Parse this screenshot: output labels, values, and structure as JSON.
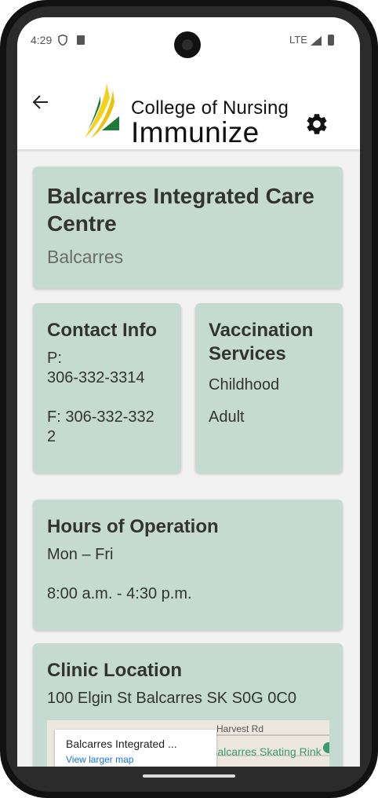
{
  "status": {
    "time": "4:29",
    "network": "LTE"
  },
  "appbar": {
    "logo_line1": "College of Nursing",
    "logo_line2": "Immunize"
  },
  "clinic": {
    "name": "Balcarres Integrated Care Centre",
    "town": "Balcarres"
  },
  "contact": {
    "heading": "Contact Info",
    "phone_prefix": "P:",
    "phone": "306-332-3314",
    "fax_line1": "F: 306-332-332",
    "fax_line2": "2"
  },
  "vaccination": {
    "heading": "Vaccination Services",
    "services": [
      "Childhood",
      "Adult"
    ]
  },
  "hours": {
    "heading": "Hours of Operation",
    "days": "Mon – Fri",
    "time": "8:00 a.m. - 4:30 p.m."
  },
  "location": {
    "heading": "Clinic Location",
    "address": "100 Elgin St Balcarres SK S0G 0C0",
    "map": {
      "popup_title": "Balcarres Integrated ...",
      "popup_link": "View larger map",
      "road_label": "Harvest Rd",
      "poi_label": "Balcarres Skating Rink"
    }
  },
  "colors": {
    "card_bg": "#c5dbd1",
    "logo_green": "#1f7a3a",
    "logo_yellow": "#f2d21b"
  }
}
